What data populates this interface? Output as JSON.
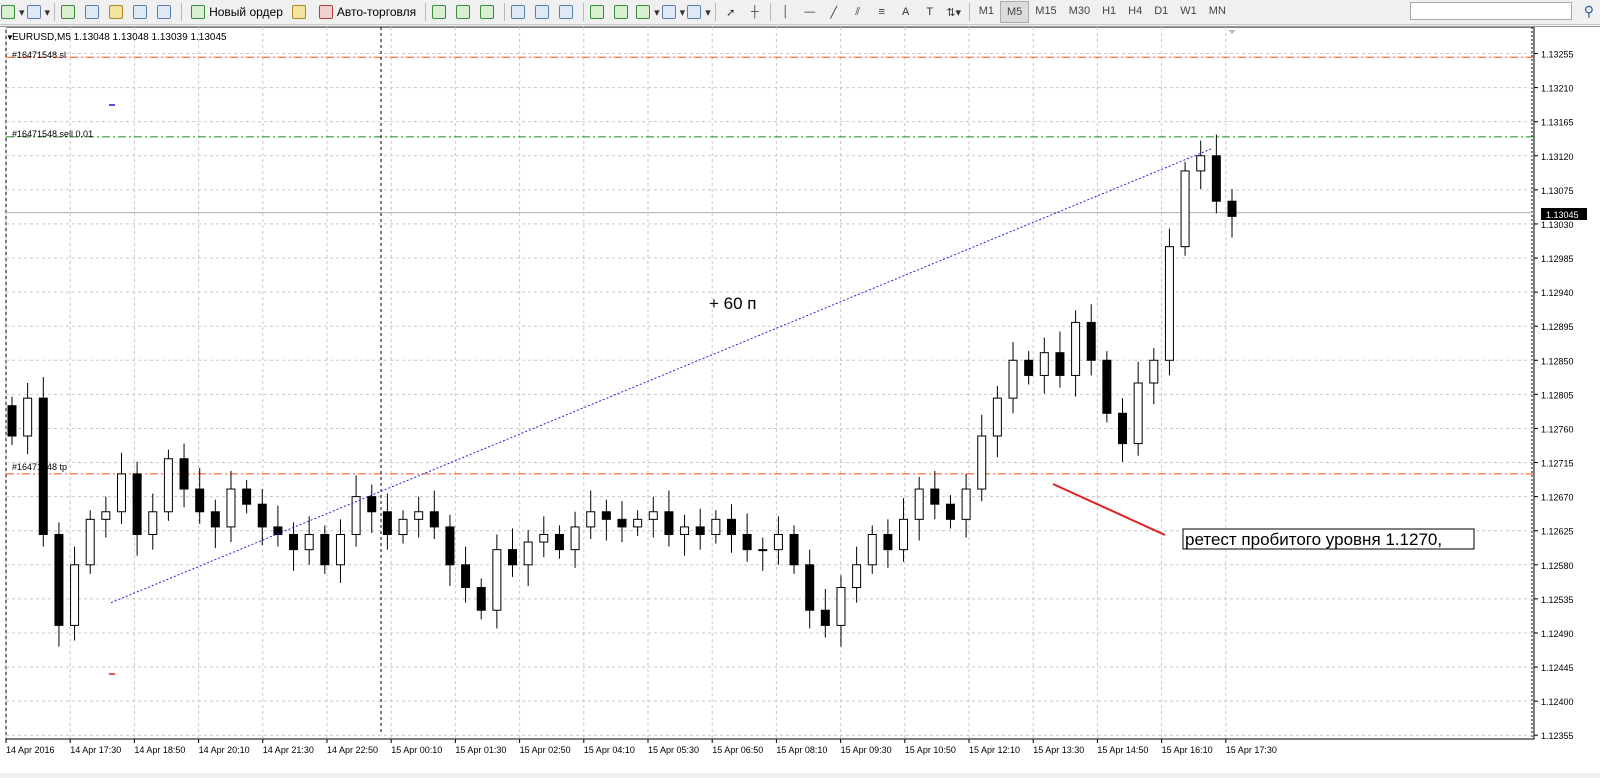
{
  "toolbar": {
    "new_order": "Новый ордер",
    "auto_trading": "Авто-торговля",
    "timeframes": [
      "M1",
      "M5",
      "M15",
      "M30",
      "H1",
      "H4",
      "D1",
      "W1",
      "MN"
    ],
    "active_timeframe": "M5",
    "text_tool": "A",
    "text_label_tool": "T"
  },
  "chart": {
    "symbol_line": "EURUSD,M5  1.13048 1.13048 1.13039 1.13045",
    "current_price": "1.13045",
    "sl_label": "#16471548 sl",
    "order_label": "#16471548 sell 0.01",
    "tp_label": "#16471548 tp",
    "annotation_pips": "+ 60 п",
    "annotation_retest": "ретест пробитого уровня 1.1270,"
  },
  "chart_data": {
    "type": "candlestick",
    "symbol": "EURUSD",
    "timeframe": "M5",
    "ohlc_last": {
      "open": 1.13048,
      "high": 1.13048,
      "low": 1.13039,
      "close": 1.13045
    },
    "y_ticks": [
      "1.13255",
      "1.13210",
      "1.13165",
      "1.13120",
      "1.13075",
      "1.13030",
      "1.12985",
      "1.12940",
      "1.12895",
      "1.12850",
      "1.12805",
      "1.12760",
      "1.12715",
      "1.12670",
      "1.12625",
      "1.12580",
      "1.12535",
      "1.12490",
      "1.12445",
      "1.12400",
      "1.12355"
    ],
    "x_ticks": [
      "14 Apr 2016",
      "14 Apr 17:30",
      "14 Apr 18:50",
      "14 Apr 20:10",
      "14 Apr 21:30",
      "14 Apr 22:50",
      "15 Apr 00:10",
      "15 Apr 01:30",
      "15 Apr 02:50",
      "15 Apr 04:10",
      "15 Apr 05:30",
      "15 Apr 06:50",
      "15 Apr 08:10",
      "15 Apr 09:30",
      "15 Apr 10:50",
      "15 Apr 12:10",
      "15 Apr 13:30",
      "15 Apr 14:50",
      "15 Apr 16:10",
      "15 Apr 17:30"
    ],
    "ylim": [
      1.1235,
      1.1329
    ],
    "levels": {
      "stop_loss": 1.1325,
      "entry_sell": 1.13145,
      "take_profit": 1.127,
      "current": 1.13045
    },
    "trend_line": {
      "from": {
        "time": "14 Apr 17:30",
        "price": 1.1253
      },
      "to": {
        "time": "15 Apr 16:40",
        "price": 1.1313
      }
    },
    "closes": [
      1.1275,
      1.128,
      1.1262,
      1.125,
      1.1258,
      1.1264,
      1.1265,
      1.127,
      1.1262,
      1.1265,
      1.1272,
      1.1268,
      1.1265,
      1.1263,
      1.1268,
      1.1266,
      1.1263,
      1.1262,
      1.126,
      1.1262,
      1.1258,
      1.1262,
      1.1267,
      1.1265,
      1.1262,
      1.1264,
      1.1265,
      1.1263,
      1.1258,
      1.1255,
      1.1252,
      1.126,
      1.1258,
      1.1261,
      1.1262,
      1.126,
      1.1263,
      1.1265,
      1.1264,
      1.1263,
      1.1264,
      1.1265,
      1.1262,
      1.1263,
      1.1262,
      1.1264,
      1.1262,
      1.126,
      1.126,
      1.1262,
      1.1258,
      1.1252,
      1.125,
      1.1255,
      1.1258,
      1.1262,
      1.126,
      1.1264,
      1.1268,
      1.1266,
      1.1264,
      1.1268,
      1.1275,
      1.128,
      1.1285,
      1.1283,
      1.1286,
      1.1283,
      1.129,
      1.1285,
      1.1278,
      1.1274,
      1.1282,
      1.1285,
      1.13,
      1.131,
      1.1312,
      1.1306,
      1.1304
    ]
  }
}
